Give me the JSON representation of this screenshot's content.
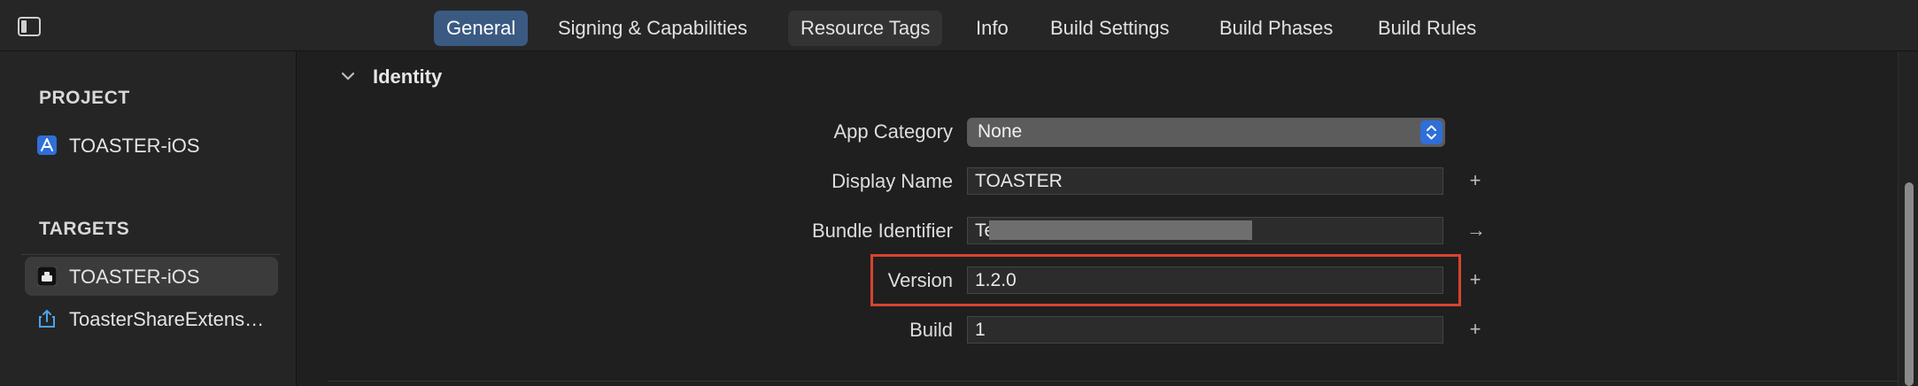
{
  "toolbar": {
    "tabs": [
      {
        "label": "General"
      },
      {
        "label": "Signing & Capabilities"
      },
      {
        "label": "Resource Tags"
      },
      {
        "label": "Info"
      },
      {
        "label": "Build Settings"
      },
      {
        "label": "Build Phases"
      },
      {
        "label": "Build Rules"
      }
    ],
    "selected_tab": "General",
    "icons": {
      "sidebar_toggle": "sidebar-toggle-icon"
    }
  },
  "sidebar": {
    "project_header": "PROJECT",
    "project_items": [
      {
        "label": "TOASTER-iOS",
        "icon": "project-app-icon"
      }
    ],
    "targets_header": "TARGETS",
    "target_items": [
      {
        "label": "TOASTER-iOS",
        "icon": "app-target-icon",
        "selected": true
      },
      {
        "label": "ToasterShareExtens…",
        "icon": "share-extension-icon",
        "selected": false
      }
    ]
  },
  "identity": {
    "section_title": "Identity",
    "app_category": {
      "label": "App Category",
      "value": "None"
    },
    "display_name": {
      "label": "Display Name",
      "value": "TOASTER"
    },
    "bundle_identifier": {
      "label": "Bundle Identifier",
      "value": "Te"
    },
    "version": {
      "label": "Version",
      "value": "1.2.0"
    },
    "build": {
      "label": "Build",
      "value": "1"
    },
    "side_buttons": {
      "add": "+",
      "arrow": "→"
    }
  },
  "colors": {
    "accent": "#3a5a82",
    "select_button": "#2f6fd8",
    "highlight_border": "#d9432f",
    "background": "#1f1f1f"
  }
}
